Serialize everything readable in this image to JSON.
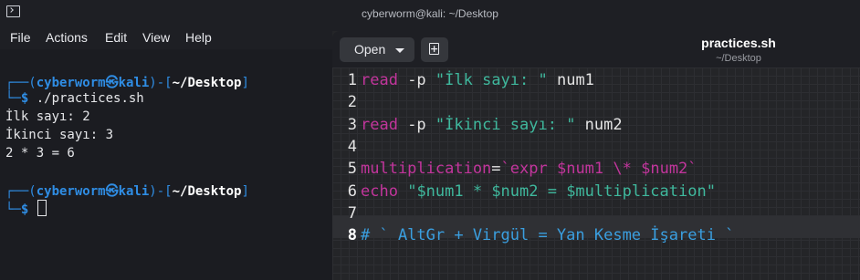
{
  "window": {
    "title": "cyberworm@kali: ~/Desktop"
  },
  "menu": {
    "items": [
      "File",
      "Actions",
      "Edit",
      "View",
      "Help"
    ]
  },
  "terminal": {
    "prompt1": {
      "open": "┌──(",
      "user": "cyberworm",
      "skull": "㉿",
      "host": "kali",
      "mid": ")-[",
      "dir": "~/Desktop",
      "close": "]"
    },
    "cmd1": {
      "arrow": "└─",
      "dollar": "$",
      "text": " ./practices.sh"
    },
    "output": [
      "İlk sayı: 2",
      "İkinci sayı: 3",
      "2 * 3 = 6"
    ],
    "prompt2": {
      "open": "┌──(",
      "user": "cyberworm",
      "skull": "㉿",
      "host": "kali",
      "mid": ")-[",
      "dir": "~/Desktop",
      "close": "]"
    },
    "cmd2": {
      "arrow": "└─",
      "dollar": "$"
    }
  },
  "editor": {
    "open_label": "Open",
    "file_title": "practices.sh",
    "file_path": "~/Desktop",
    "active_line": 8,
    "lines": [
      {
        "num": "1",
        "t": [
          {
            "cls": "k",
            "text": "read"
          },
          {
            "cls": "p",
            "text": " -p "
          },
          {
            "cls": "s",
            "text": "\"İlk sayı: \""
          },
          {
            "cls": "p",
            "text": " num1"
          }
        ]
      },
      {
        "num": "2",
        "t": []
      },
      {
        "num": "3",
        "t": [
          {
            "cls": "k",
            "text": "read"
          },
          {
            "cls": "p",
            "text": " -p "
          },
          {
            "cls": "s",
            "text": "\"İkinci sayı: \""
          },
          {
            "cls": "p",
            "text": " num2"
          }
        ]
      },
      {
        "num": "4",
        "t": []
      },
      {
        "num": "5",
        "t": [
          {
            "cls": "v",
            "text": "multiplication"
          },
          {
            "cls": "p",
            "text": "="
          },
          {
            "cls": "k",
            "text": "`expr "
          },
          {
            "cls": "k",
            "text": "$num1"
          },
          {
            "cls": "k",
            "text": " \\* "
          },
          {
            "cls": "k",
            "text": "$num2"
          },
          {
            "cls": "k",
            "text": "`"
          }
        ]
      },
      {
        "num": "6",
        "t": [
          {
            "cls": "k",
            "text": "echo"
          },
          {
            "cls": "p",
            "text": " "
          },
          {
            "cls": "s",
            "text": "\"$num1 * $num2 = $multiplication\""
          }
        ]
      },
      {
        "num": "7",
        "t": []
      },
      {
        "num": "8",
        "t": [
          {
            "cls": "c",
            "text": "# ` AltGr + Virgül = Yan Kesme İşareti `"
          }
        ]
      }
    ]
  },
  "colors": {
    "accent_blue": "#2f8de4",
    "keyword_pink": "#c2359c",
    "string_green": "#3fb89d",
    "comment_blue": "#3a9fe0"
  }
}
